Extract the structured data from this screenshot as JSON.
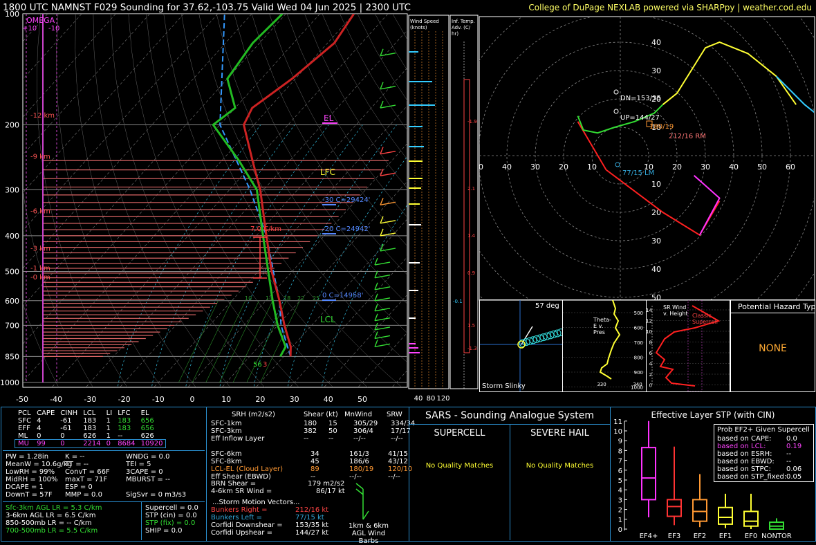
{
  "header": {
    "title": "1800 UTC NAMNST F029 Sounding for 37.62,-103.75 Valid  Wed 04 Jun 2025 | 2300 UTC",
    "credit": "College of DuPage NEXLAB powered via SHARPpy | weather.cod.edu"
  },
  "colors": {
    "temperature": "#cc2222",
    "dewpoint": "#22bb22",
    "parcel": "#3399ff",
    "omega": "#cc44cc",
    "hodo_low": "#ff2020",
    "hodo_mid": "#33dd33",
    "hodo_high": "#ffff33",
    "hodo_upper": "#33ccff"
  },
  "chart_data": [
    {
      "type": "line",
      "name": "skew-t",
      "pressure_ticks": [
        100,
        200,
        300,
        400,
        500,
        600,
        700,
        850,
        1000
      ],
      "temp_ticks": [
        -50,
        -40,
        -30,
        -20,
        -10,
        0,
        10,
        20,
        30,
        40,
        50
      ],
      "height_labels": [
        "12 km",
        "9 km",
        "6 km",
        "3 km",
        "1 km",
        "0 km"
      ],
      "omega_labels": {
        "title": "OMEGA",
        "left": "+10",
        "right": "-10"
      },
      "temperature_profile": [
        [
          850,
          22
        ],
        [
          800,
          19.5
        ],
        [
          700,
          12
        ],
        [
          600,
          4
        ],
        [
          500,
          -6
        ],
        [
          400,
          -17
        ],
        [
          300,
          -31
        ],
        [
          250,
          -41
        ],
        [
          200,
          -53
        ],
        [
          180,
          -55
        ],
        [
          150,
          -51
        ],
        [
          120,
          -48
        ],
        [
          100,
          -50
        ]
      ],
      "dewpoint_profile": [
        [
          850,
          19
        ],
        [
          800,
          18
        ],
        [
          700,
          10
        ],
        [
          600,
          2
        ],
        [
          500,
          -7
        ],
        [
          400,
          -18
        ],
        [
          300,
          -32
        ],
        [
          250,
          -45
        ],
        [
          200,
          -62
        ],
        [
          180,
          -60
        ],
        [
          150,
          -70
        ],
        [
          120,
          -72
        ],
        [
          100,
          -71
        ]
      ],
      "parcel_profile": [
        [
          850,
          22
        ],
        [
          700,
          11
        ],
        [
          600,
          4
        ],
        [
          500,
          -5.5
        ],
        [
          400,
          -17
        ],
        [
          300,
          -34
        ],
        [
          200,
          -60
        ],
        [
          100,
          -88
        ]
      ],
      "annotations": {
        "el": "EL",
        "lfc": "LFC",
        "lcl": "LCL",
        "lapse": "7.0 C/km",
        "m30": "-30 C=29424'",
        "m20": "-20 C=24942'",
        "zero": "0 C=14958'",
        "sfc_t": "56",
        "sfc_td": "3"
      },
      "wetbulb_labels": [
        "10",
        "14",
        "18",
        "22",
        "25"
      ]
    },
    {
      "type": "bar",
      "name": "wind-speed-profile",
      "title": "Wind Speed (knots)",
      "ticks": [
        "40",
        "80",
        "120"
      ]
    },
    {
      "type": "line",
      "name": "inferred-temperature-advection",
      "title": "Inf. Temp. Adv. (C/hr)",
      "values": [
        "-1.9",
        "2.1",
        "1.4",
        "0.9",
        "-0.1",
        "1.5",
        "-1.3"
      ]
    },
    {
      "type": "line",
      "name": "hodograph",
      "rings": [
        "10",
        "20",
        "30",
        "40",
        "50",
        "60"
      ],
      "x_ticks": [
        "70",
        "60",
        "50",
        "40",
        "30",
        "20",
        "10",
        "10",
        "20",
        "30",
        "40",
        "50",
        "60",
        "70",
        "80"
      ],
      "labels": {
        "dn": "DN=153/35",
        "up": "UP=144/27",
        "rm": "212/16 RM",
        "lm": "77/15 LM",
        "mean": "180/19"
      }
    },
    {
      "type": "bar",
      "name": "effective-layer-stp",
      "title": "Effective Layer STP (with CIN)",
      "categories": [
        "EF4+",
        "EF3",
        "EF2",
        "EF1",
        "EF0",
        "NONTOR"
      ],
      "yticks": [
        "0",
        "1",
        "2",
        "3",
        "4",
        "5",
        "6",
        "7",
        "8",
        "9",
        "10",
        "11"
      ],
      "box": [
        {
          "whisker_low": 1.2,
          "q1": 3.0,
          "median": 5.2,
          "q3": 8.3,
          "whisker_high": 11.0
        },
        {
          "whisker_low": 0.4,
          "q1": 1.3,
          "median": 2.3,
          "q3": 3.0,
          "whisker_high": 8.4
        },
        {
          "whisker_low": 0.2,
          "q1": 0.8,
          "median": 1.8,
          "q3": 3.0,
          "whisker_high": 5.6
        },
        {
          "whisker_low": 0.1,
          "q1": 0.5,
          "median": 1.2,
          "q3": 2.2,
          "whisker_high": 3.6
        },
        {
          "whisker_low": 0.0,
          "q1": 0.3,
          "median": 0.8,
          "q3": 1.8,
          "whisker_high": 3.6
        },
        {
          "whisker_low": 0.0,
          "q1": 0.0,
          "median": 0.3,
          "q3": 0.7,
          "whisker_high": 1.1
        }
      ],
      "colors": [
        "#ff33ff",
        "#ff3333",
        "#ff9933",
        "#ffff33",
        "#ffff33",
        "#33dd33"
      ],
      "legend": {
        "title": "Prob EF2+ Given Supercell",
        "rows": [
          {
            "label": "based on CAPE:",
            "value": "0.0"
          },
          {
            "label": "based on LCL:",
            "value": "0.19"
          },
          {
            "label": "based on ESRH:",
            "value": "--"
          },
          {
            "label": "based on EBWD:",
            "value": "--"
          },
          {
            "label": "based on STPC:",
            "value": "0.06"
          },
          {
            "label": "based on STP_fixed:",
            "value": "0.05"
          }
        ]
      }
    }
  ],
  "slinky": {
    "title": "Storm Slinky",
    "deg": "57 deg"
  },
  "theta_e": {
    "title": "Theta-E v. Pres",
    "ticks": [
      "500",
      "600",
      "700",
      "800",
      "900",
      "1000"
    ],
    "xticks": [
      "330",
      "340"
    ]
  },
  "srwind": {
    "title": "SR Wind v. Height",
    "ticks": [
      "14",
      "12",
      "10",
      "8",
      "6",
      "4",
      "2",
      "0"
    ],
    "label": "Classic Supercell"
  },
  "hazard": {
    "title": "Potential Hazard Type",
    "value": "NONE"
  },
  "parcels": {
    "headers": [
      "PCL",
      "CAPE",
      "CINH",
      "LCL",
      "LI",
      "LFC",
      "EL"
    ],
    "rows": [
      [
        "SFC",
        "4",
        "-61",
        "183",
        "1",
        "183",
        "656"
      ],
      [
        "EFF",
        "4",
        "-61",
        "183",
        "1",
        "183",
        "656"
      ],
      [
        "ML",
        "0",
        "0",
        "626",
        "1",
        "--",
        "626"
      ],
      [
        "MU",
        "99",
        "0",
        "2214",
        "0",
        "8684",
        "10920"
      ]
    ]
  },
  "thermo": {
    "col1": [
      "PW = 1.28in",
      "MeanW = 10.6g/kg",
      "LowRH = 99%",
      "MidRH = 100%",
      "DCAPE = 1",
      "DownT = 57F"
    ],
    "col2": [
      "K = --",
      "TT = --",
      "ConvT = 66F",
      "maxT = 71F",
      "ESP = 0",
      "MMP = 0.0"
    ],
    "col3": [
      "WNDG = 0.0",
      "TEI = 5",
      "3CAPE = 0",
      "MBURST = --",
      "",
      "SigSvr = 0 m3/s3"
    ]
  },
  "lapse": [
    "Sfc-3km AGL LR = 5.3 C/km",
    "3-6km AGL LR = 6.5 C/km",
    "850-500mb LR = -- C/km",
    "700-500mb LR = 5.5 C/km"
  ],
  "composites": [
    "Supercell = 0.0",
    "STP (cin) = 0.0",
    "STP (fix) = 0.0",
    "SHIP = 0.0"
  ],
  "kinematics": {
    "headers": [
      "SRH (m2/s2)",
      "Shear (kt)",
      "MnWind",
      "SRW"
    ],
    "rows": [
      [
        "SFC-1km",
        "180",
        "15",
        "305/29",
        "334/34"
      ],
      [
        "SFC-3km",
        "382",
        "50",
        "306/4",
        "17/17"
      ],
      [
        "Eff Inflow Layer",
        "--",
        "--",
        "--/--",
        "--/--"
      ],
      [
        "",
        "",
        "",
        "",
        ""
      ],
      [
        "SFC-6km",
        "34",
        "161/3",
        "41/15",
        ""
      ],
      [
        "SFC-8km",
        "45",
        "186/6",
        "43/12",
        ""
      ],
      [
        "LCL-EL (Cloud Layer)",
        "89",
        "180/19",
        "120/10",
        ""
      ],
      [
        "Eff Shear (EBWD)",
        "--",
        "--/--",
        "--/--",
        ""
      ]
    ],
    "brn": "BRN Shear =",
    "brn_v": "179 m2/s2",
    "srw46": "4-6km SR Wind =",
    "srw46_v": "86/17 kt",
    "motion_title": "...Storm Motion Vectors...",
    "motions": [
      {
        "label": "Bunkers Right =",
        "value": "212/16 kt"
      },
      {
        "label": "Bunkers Left =",
        "value": "77/15 kt"
      },
      {
        "label": "Corfidi Downshear =",
        "value": "153/35 kt"
      },
      {
        "label": "Corfidi Upshear =",
        "value": "144/27 kt"
      }
    ],
    "barb_label": "1km & 6km AGL Wind Barbs"
  },
  "sars": {
    "title": "SARS - Sounding Analogue System",
    "supercell": "SUPERCELL",
    "hail": "SEVERE HAIL",
    "no_match": "No Quality Matches"
  }
}
